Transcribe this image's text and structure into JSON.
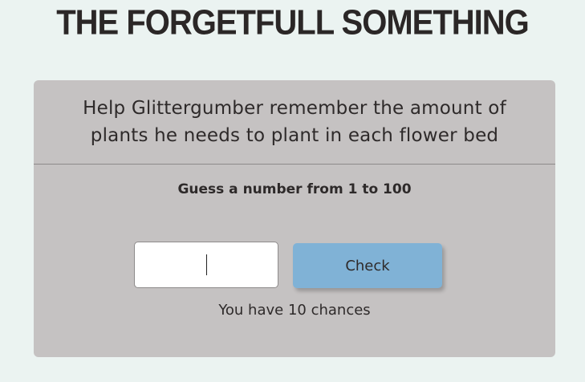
{
  "page": {
    "title": "THE FORGETFULL SOMETHING"
  },
  "card": {
    "header_text": "Help Glittergumber remember the amount of plants he needs to plant in each flower bed",
    "prompt": "Guess a number from 1 to 100",
    "input": {
      "value": "",
      "placeholder": ""
    },
    "check_label": "Check",
    "chances_text": "You have 10 chances"
  },
  "colors": {
    "background": "#ebf3f1",
    "card": "#c5c2c2",
    "button": "#80b2d6",
    "text": "#2e2a2a"
  }
}
